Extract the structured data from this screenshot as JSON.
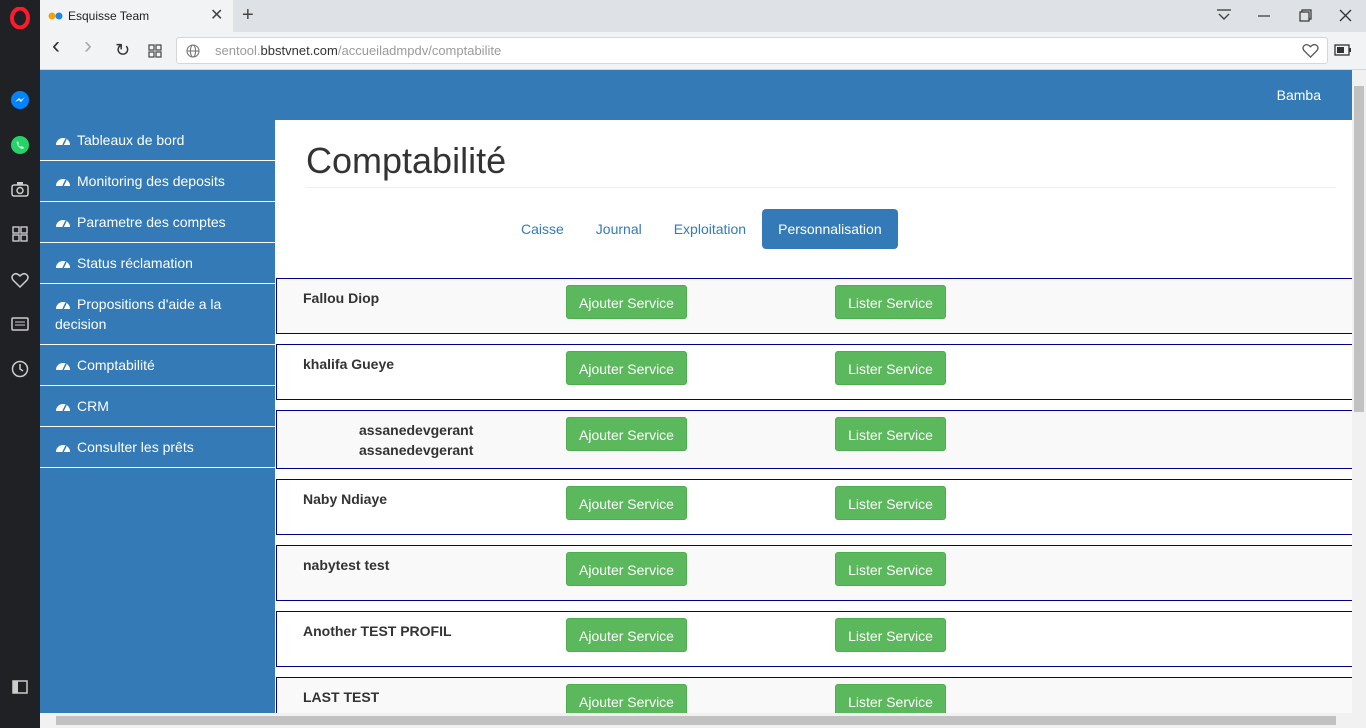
{
  "browser": {
    "tab_title": "Esquisse Team",
    "close_tab_glyph": "✕",
    "new_tab_glyph": "+",
    "url_prefix": "sentool.",
    "url_host": "bbstvnet.com",
    "url_path": "/accueiladmpdv/comptabilite",
    "back_glyph": "‹",
    "forward_glyph": "›",
    "reload_glyph": "↻"
  },
  "header": {
    "user": "Bamba"
  },
  "sidebar": {
    "items": [
      {
        "label": "Tableaux de bord"
      },
      {
        "label": "Monitoring des deposits"
      },
      {
        "label": "Parametre des comptes"
      },
      {
        "label": "Status réclamation"
      },
      {
        "label": "Propositions d'aide a la decision"
      },
      {
        "label": "Comptabilité"
      },
      {
        "label": "CRM"
      },
      {
        "label": "Consulter les prêts"
      }
    ]
  },
  "main": {
    "title": "Comptabilité",
    "tabs": [
      {
        "label": "Caisse"
      },
      {
        "label": "Journal"
      },
      {
        "label": "Exploitation"
      },
      {
        "label": "Personnalisation",
        "active": true
      }
    ],
    "add_label": "Ajouter Service",
    "list_label": "Lister Service",
    "rows": [
      {
        "name": "Fallou Diop"
      },
      {
        "name": "khalifa Gueye"
      },
      {
        "name": "assanedevgerant assanedevgerant"
      },
      {
        "name": "Naby Ndiaye"
      },
      {
        "name": "nabytest test"
      },
      {
        "name": "Another TEST PROFIL"
      },
      {
        "name": "LAST TEST"
      }
    ]
  },
  "colors": {
    "primary": "#337ab7",
    "success": "#5cb85c",
    "row_border": "#00008b"
  }
}
